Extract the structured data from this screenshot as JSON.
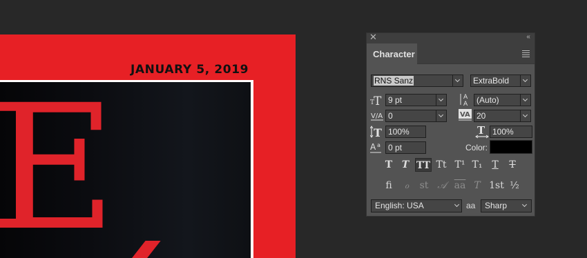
{
  "canvas": {
    "date_text": "JANUARY 5, 2019",
    "headline_letter": "E"
  },
  "panel": {
    "tab": "Character",
    "icons": {
      "close": "✕",
      "collapse": "‹‹"
    },
    "font_family": "RNS Sanz",
    "font_style": "ExtraBold",
    "font_size": "9 pt",
    "leading": "(Auto)",
    "kerning": "0",
    "tracking": "20",
    "vertical_scale": "100%",
    "horizontal_scale": "100%",
    "baseline_shift": "0 pt",
    "color_label": "Color:",
    "color_value": "#000000",
    "language": "English: USA",
    "antialias": "Sharp",
    "antialias_icon": "aa",
    "type_style_buttons": [
      {
        "name": "faux-bold",
        "glyph": "T"
      },
      {
        "name": "faux-italic",
        "glyph": "T"
      },
      {
        "name": "all-caps",
        "glyph": "TT"
      },
      {
        "name": "small-caps",
        "glyph": "Tt"
      },
      {
        "name": "superscript",
        "glyph": "T¹"
      },
      {
        "name": "subscript",
        "glyph": "T₁"
      },
      {
        "name": "underline",
        "glyph": "T"
      },
      {
        "name": "strikethrough",
        "glyph": "T"
      }
    ],
    "opentype_buttons": [
      {
        "name": "ligatures",
        "glyph": "fi"
      },
      {
        "name": "discretionary-ligatures",
        "glyph": "ℴ"
      },
      {
        "name": "oldstyle",
        "glyph": "st"
      },
      {
        "name": "swash",
        "glyph": "𝒜"
      },
      {
        "name": "stylistic-alternates",
        "glyph": "aa"
      },
      {
        "name": "titling",
        "glyph": "T"
      },
      {
        "name": "ordinals",
        "glyph": "1st"
      },
      {
        "name": "fractions",
        "glyph": "½"
      }
    ]
  }
}
